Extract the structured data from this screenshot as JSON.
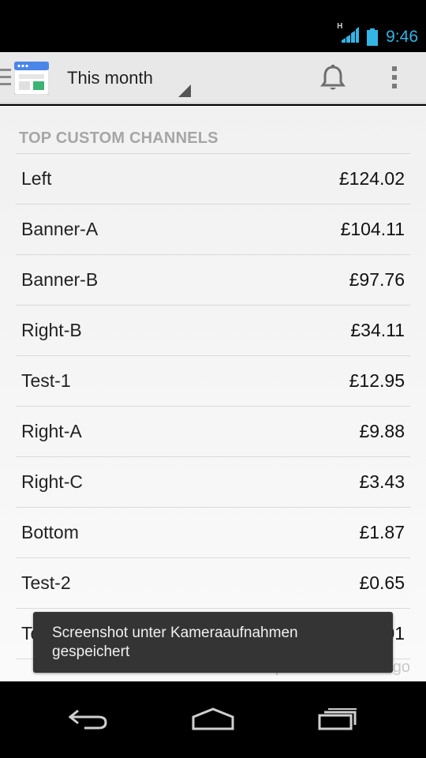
{
  "status_bar": {
    "time": "9:46",
    "network_type": "H",
    "icons": [
      "signal-icon",
      "battery-icon"
    ]
  },
  "action_bar": {
    "app_icon": "adsense-app-icon",
    "period_selector": "This month",
    "notifications_icon": "bell-icon",
    "menu_icon": "overflow-menu-icon"
  },
  "report": {
    "section_title": "TOP CUSTOM CHANNELS",
    "channels": [
      {
        "name": "Left",
        "value": "£124.02"
      },
      {
        "name": "Banner-A",
        "value": "£104.11"
      },
      {
        "name": "Banner-B",
        "value": "£97.76"
      },
      {
        "name": "Right-B",
        "value": "£34.11"
      },
      {
        "name": "Test-1",
        "value": "£12.95"
      },
      {
        "name": "Right-A",
        "value": "£9.88"
      },
      {
        "name": "Right-C",
        "value": "£3.43"
      },
      {
        "name": "Bottom",
        "value": "£1.87"
      },
      {
        "name": "Test-2",
        "value": "£0.65"
      },
      {
        "name": "Test-3",
        "value": "£0.01"
      }
    ],
    "last_updated": "Last updated: 39 min ago"
  },
  "toast": {
    "message": "Screenshot unter Kameraaufnahmen gespeichert"
  },
  "nav_bar": {
    "buttons": [
      "back-icon",
      "home-icon",
      "recent-apps-icon"
    ]
  },
  "colors": {
    "accent": "#33b5e5",
    "action_bar_bg": "#e8e8e8",
    "toast_bg": "#343434"
  }
}
